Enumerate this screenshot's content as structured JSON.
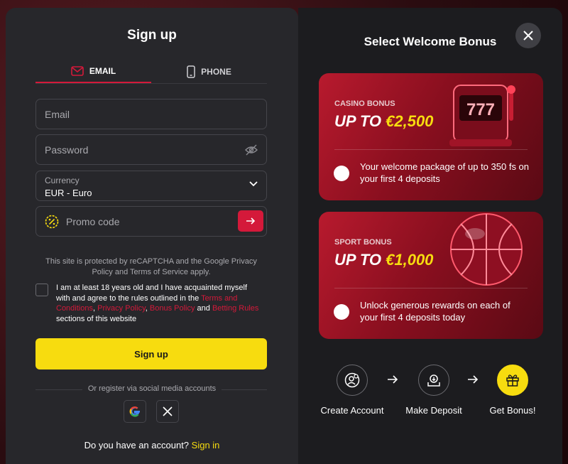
{
  "signup": {
    "title": "Sign up",
    "tab_email": "EMAIL",
    "tab_phone": "PHONE",
    "email_placeholder": "Email",
    "password_placeholder": "Password",
    "currency_label": "Currency",
    "currency_value": "EUR - Euro",
    "promo_placeholder": "Promo code",
    "recaptcha_text": "This site is protected by reCAPTCHA and the Google Privacy Policy and Terms of Service apply.",
    "agree_prefix": "I am at least 18 years old and I have acquainted myself with and agree to the rules outlined in the ",
    "terms_link": "Terms and Conditions",
    "comma1": ", ",
    "privacy_link": "Privacy Policy",
    "comma2": ", ",
    "bonus_link": "Bonus Policy",
    "and_text": " and ",
    "betting_link": "Betting Rules",
    "agree_suffix": " sections of this website",
    "signup_button": "Sign up",
    "social_label": "Or register via social media accounts",
    "account_question": "Do you have an account?",
    "sign_in_link": "Sign in"
  },
  "bonus": {
    "title": "Select Welcome Bonus",
    "cards": [
      {
        "kind": "CASINO BONUS",
        "amount_prefix": "UP TO ",
        "amount": "€2,500",
        "description": "Your welcome package of up to 350 fs on your first 4 deposits",
        "icon": "slot-machine-icon"
      },
      {
        "kind": "SPORT BONUS",
        "amount_prefix": "UP TO ",
        "amount": "€1,000",
        "description": "Unlock generous rewards on each of your first 4 deposits today",
        "icon": "basketball-icon"
      }
    ],
    "steps": [
      {
        "label": "Create Account",
        "icon": "user-add-icon"
      },
      {
        "label": "Make Deposit",
        "icon": "deposit-icon"
      },
      {
        "label": "Get Bonus!",
        "icon": "gift-icon"
      }
    ]
  },
  "colors": {
    "accent_red": "#d4193a",
    "accent_yellow": "#f7dc0f",
    "panel_dark": "#27272b"
  }
}
